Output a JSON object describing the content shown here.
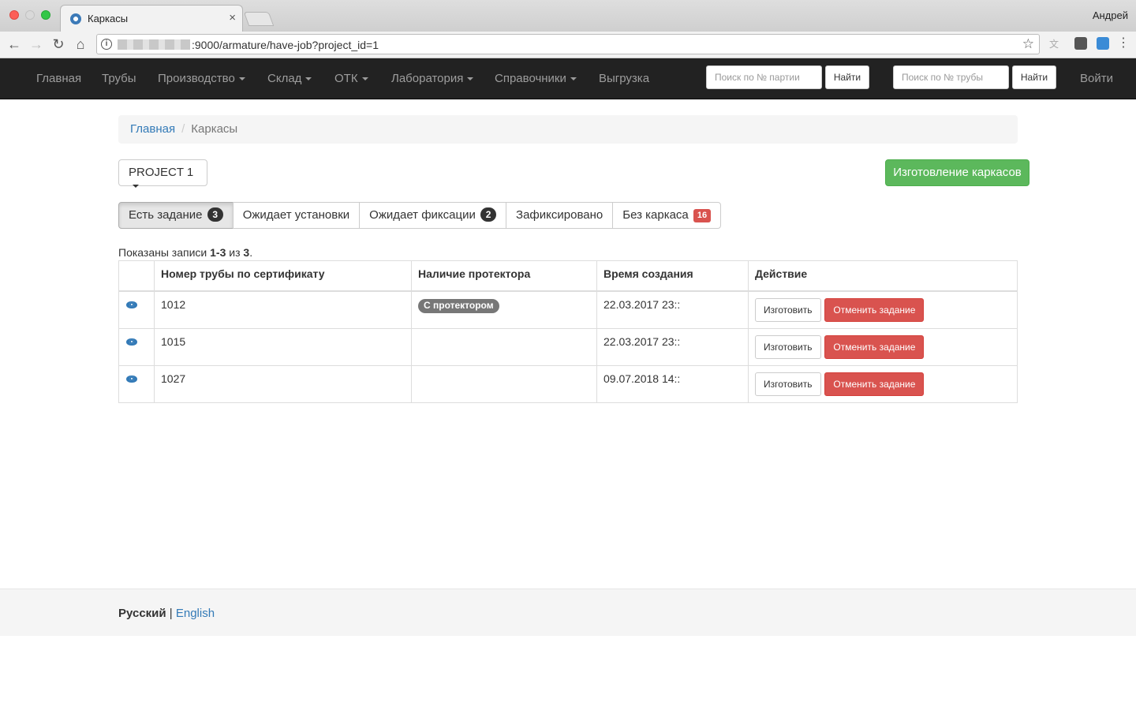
{
  "browser": {
    "tab_title": "Каркасы",
    "tab_close": "×",
    "profile_name": "Андрей",
    "url_suffix": ":9000/armature/have-job?project_id=1"
  },
  "navbar": {
    "items": [
      {
        "label": "Главная",
        "dropdown": false
      },
      {
        "label": "Трубы",
        "dropdown": false
      },
      {
        "label": "Производство",
        "dropdown": true
      },
      {
        "label": "Склад",
        "dropdown": true
      },
      {
        "label": "ОТК",
        "dropdown": true
      },
      {
        "label": "Лаборатория",
        "dropdown": true
      },
      {
        "label": "Справочники",
        "dropdown": true
      },
      {
        "label": "Выгрузка",
        "dropdown": false
      }
    ],
    "search_batch_placeholder": "Поиск по № партии",
    "search_pipe_placeholder": "Поиск по № трубы",
    "find_label": "Найти",
    "login_label": "Войти"
  },
  "breadcrumb": {
    "home": "Главная",
    "separator": "/",
    "current": "Каркасы"
  },
  "project_select": "PROJECT 1",
  "make_button": "Изготовление каркасов",
  "filter_tabs": [
    {
      "label": "Есть задание",
      "badge": "3",
      "active": true
    },
    {
      "label": "Ожидает установки",
      "badge": "",
      "active": false
    },
    {
      "label": "Ожидает фиксации",
      "badge": "2",
      "active": false
    },
    {
      "label": "Зафиксировано",
      "badge": "",
      "active": false
    },
    {
      "label": "Без каркаса",
      "badge": "16",
      "active": false
    }
  ],
  "summary": {
    "prefix": "Показаны записи ",
    "range": "1-3",
    "middle": " из ",
    "total": "3",
    "suffix": "."
  },
  "table": {
    "headers": [
      "",
      "Номер трубы по сертификату",
      "Наличие протектора",
      "Время создания",
      "Действие"
    ],
    "rows": [
      {
        "pipe": "1012",
        "protector": "С протектором",
        "created": "22.03.2017 23::"
      },
      {
        "pipe": "1015",
        "protector": "",
        "created": "22.03.2017 23::"
      },
      {
        "pipe": "1027",
        "protector": "",
        "created": "09.07.2018 14::"
      }
    ],
    "make_label": "Изготовить",
    "cancel_label": "Отменить задание"
  },
  "footer": {
    "lang_current": "Русский",
    "separator": "|",
    "lang_other": "English"
  },
  "colors": {
    "navbar_bg": "#222222",
    "link": "#337ab7",
    "success": "#5cb85c",
    "danger": "#d9534f"
  }
}
